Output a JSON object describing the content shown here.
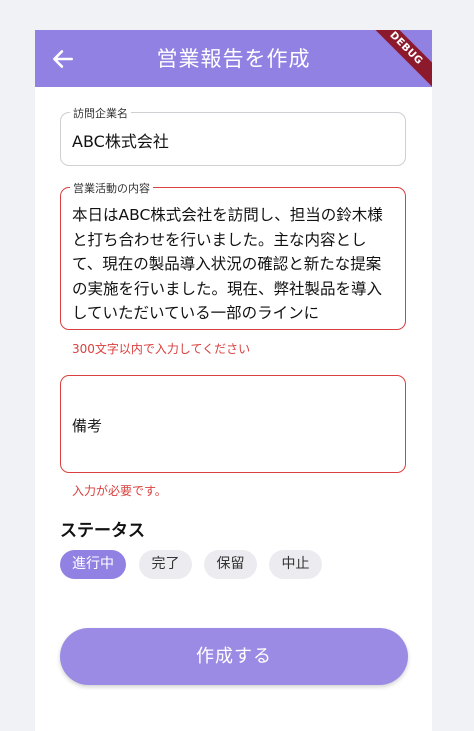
{
  "appbar": {
    "title": "営業報告を作成",
    "back_icon": "arrow-left-icon",
    "debug_banner": "DEBUG"
  },
  "form": {
    "company": {
      "label": "訪問企業名",
      "value": "ABC株式会社"
    },
    "activity": {
      "label": "営業活動の内容",
      "value": "本日はABC株式会社を訪問し、担当の鈴木様と打ち合わせを行いました。主な内容として、現在の製品導入状況の確認と新たな提案の実施を行いました。現在、弊社製品を導入していただいている一部のラインに",
      "error": "300文字以内で入力してください"
    },
    "notes": {
      "placeholder": "備考",
      "error": "入力が必要です。"
    }
  },
  "status": {
    "title": "ステータス",
    "chips": [
      {
        "label": "進行中",
        "selected": true
      },
      {
        "label": "完了",
        "selected": false
      },
      {
        "label": "保留",
        "selected": false
      },
      {
        "label": "中止",
        "selected": false
      }
    ]
  },
  "submit_label": "作成する",
  "colors": {
    "primary": "#9181e3",
    "error": "#d9403f",
    "chip_bg": "#ececf0",
    "debug": "#8d1a2c"
  }
}
